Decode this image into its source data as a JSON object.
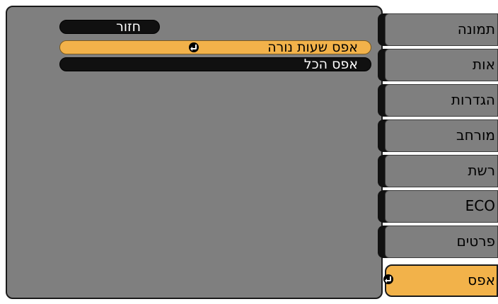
{
  "menu": {
    "back_label": "חזור",
    "options": [
      {
        "label": "אפס שעות נורה",
        "selected": true,
        "has_enter": true
      },
      {
        "label": "אפס הכל",
        "selected": false,
        "has_enter": false
      }
    ]
  },
  "tabs": [
    {
      "label": "תמונה",
      "selected": false
    },
    {
      "label": "אות",
      "selected": false
    },
    {
      "label": "הגדרות",
      "selected": false
    },
    {
      "label": "מורחב",
      "selected": false
    },
    {
      "label": "רשת",
      "selected": false
    },
    {
      "label": "ECO",
      "selected": false
    },
    {
      "label": "פרטים",
      "selected": false
    },
    {
      "label": "אפס",
      "selected": true,
      "has_enter": true
    }
  ],
  "colors": {
    "panel": "#7f7f7f",
    "highlight": "#f2b24a",
    "pill_dark": "#101010"
  },
  "icons": {
    "enter": "enter-icon"
  }
}
